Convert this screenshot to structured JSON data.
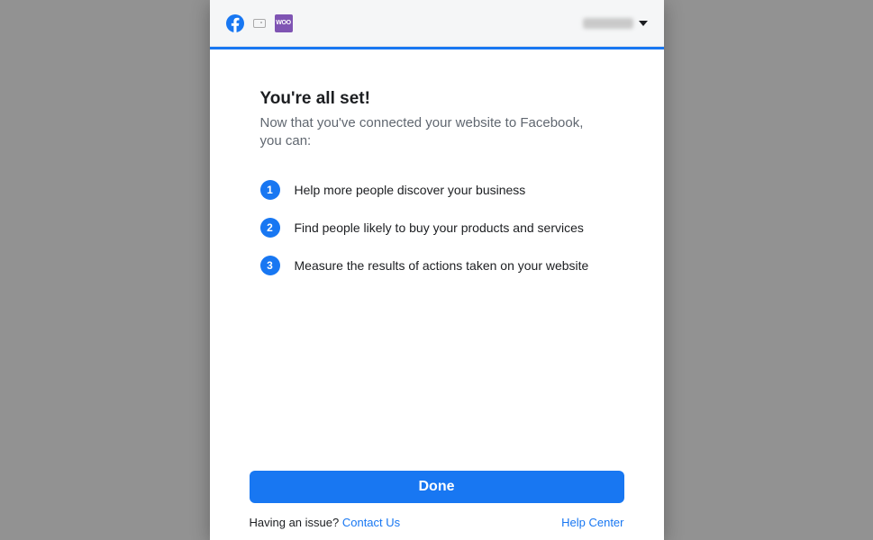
{
  "header": {
    "woo_label": "WOO"
  },
  "main": {
    "title": "You're all set!",
    "subtitle": "Now that you've connected your website to Facebook, you can:",
    "benefits": [
      {
        "num": "1",
        "text": "Help more people discover your business"
      },
      {
        "num": "2",
        "text": "Find people likely to buy your products and services"
      },
      {
        "num": "3",
        "text": "Measure the results of actions taken on your website"
      }
    ]
  },
  "footer": {
    "done_label": "Done",
    "issue_label": "Having an issue? ",
    "contact_label": "Contact Us",
    "help_label": "Help Center"
  }
}
